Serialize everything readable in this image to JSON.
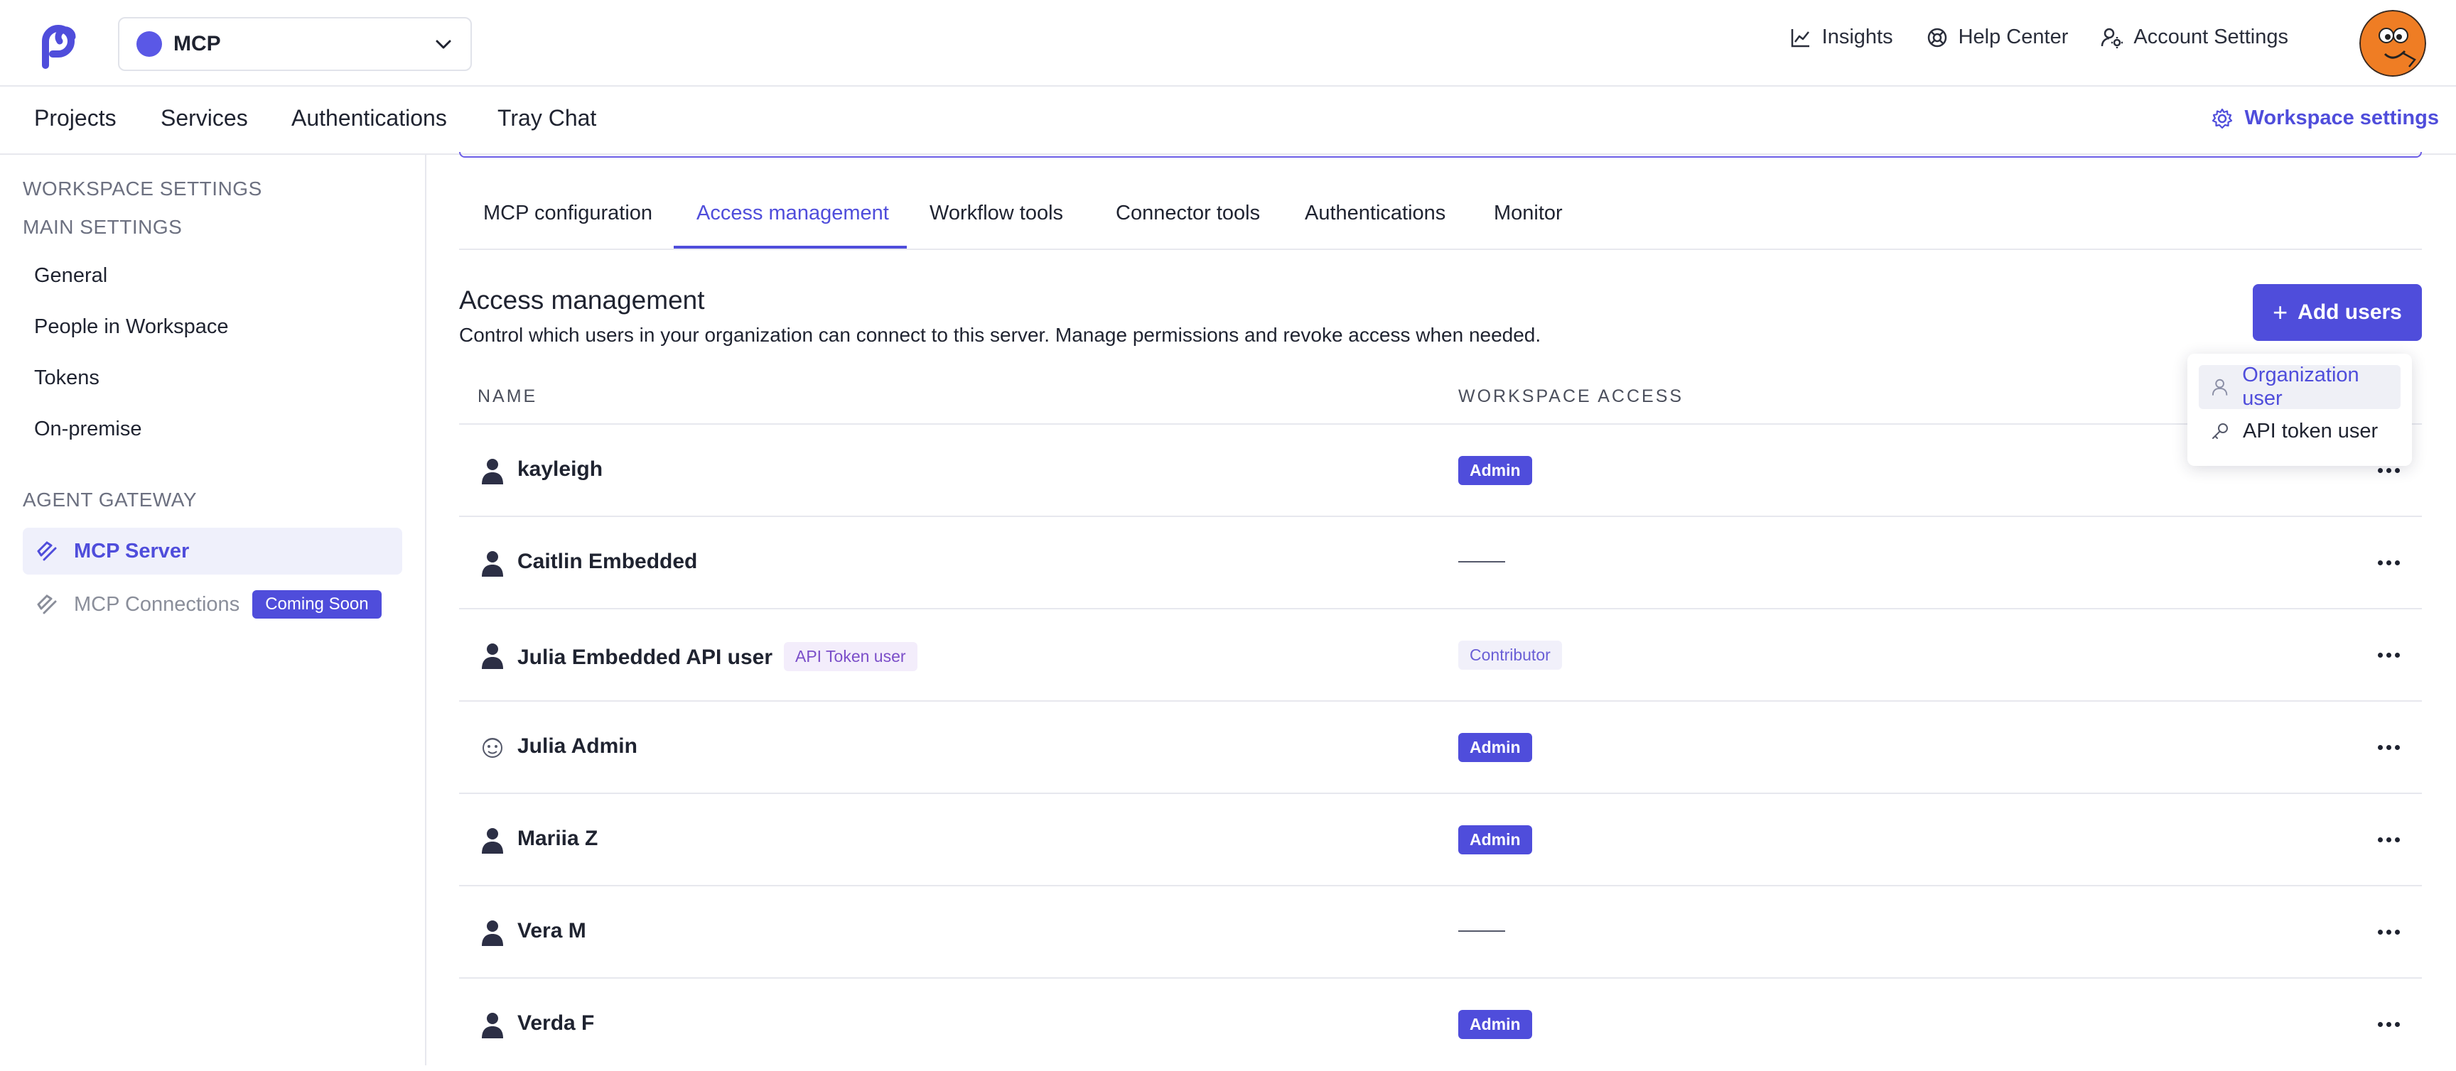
{
  "header": {
    "workspace_name": "MCP",
    "links": [
      "Insights",
      "Help Center",
      "Account Settings"
    ]
  },
  "nav": {
    "items": [
      "Projects",
      "Services",
      "Authentications",
      "Tray Chat"
    ],
    "workspace_settings": "Workspace settings"
  },
  "sidebar": {
    "section_workspace": "WORKSPACE SETTINGS",
    "section_main": "MAIN SETTINGS",
    "main_items": [
      "General",
      "People in Workspace",
      "Tokens",
      "On-premise"
    ],
    "section_agent": "AGENT GATEWAY",
    "mcp_server": "MCP Server",
    "mcp_connections": "MCP Connections",
    "coming_soon": "Coming Soon"
  },
  "tabs": [
    "MCP configuration",
    "Access management",
    "Workflow tools",
    "Connector tools",
    "Authentications",
    "Monitor"
  ],
  "content": {
    "title": "Access management",
    "description": "Control which users in your organization can connect to this server. Manage permissions and revoke access when needed.",
    "add_users": "Add users",
    "col_name": "NAME",
    "col_access": "WORKSPACE ACCESS"
  },
  "dropdown": {
    "items": [
      "Organization user",
      "API token user"
    ]
  },
  "users": [
    {
      "name": "kayleigh",
      "access": "Admin"
    },
    {
      "name": "Caitlin Embedded",
      "access": ""
    },
    {
      "name": "Julia Embedded API user",
      "tag": "API Token user",
      "access": "Contributor"
    },
    {
      "name": "Julia Admin",
      "access": "Admin"
    },
    {
      "name": "Mariia Z",
      "access": "Admin"
    },
    {
      "name": "Vera M",
      "access": ""
    },
    {
      "name": "Verda F",
      "access": "Admin"
    }
  ],
  "colors": {
    "accent": "#4f4ddb",
    "workspace_dot": "#5a58e6"
  },
  "icons": {
    "logo": "tray-logo-icon",
    "insights": "chart-line-icon",
    "help": "lifebuoy-icon",
    "account": "user-gear-icon",
    "settings": "gear-icon",
    "user": "person-icon",
    "more": "ellipsis-icon",
    "key": "key-icon"
  }
}
